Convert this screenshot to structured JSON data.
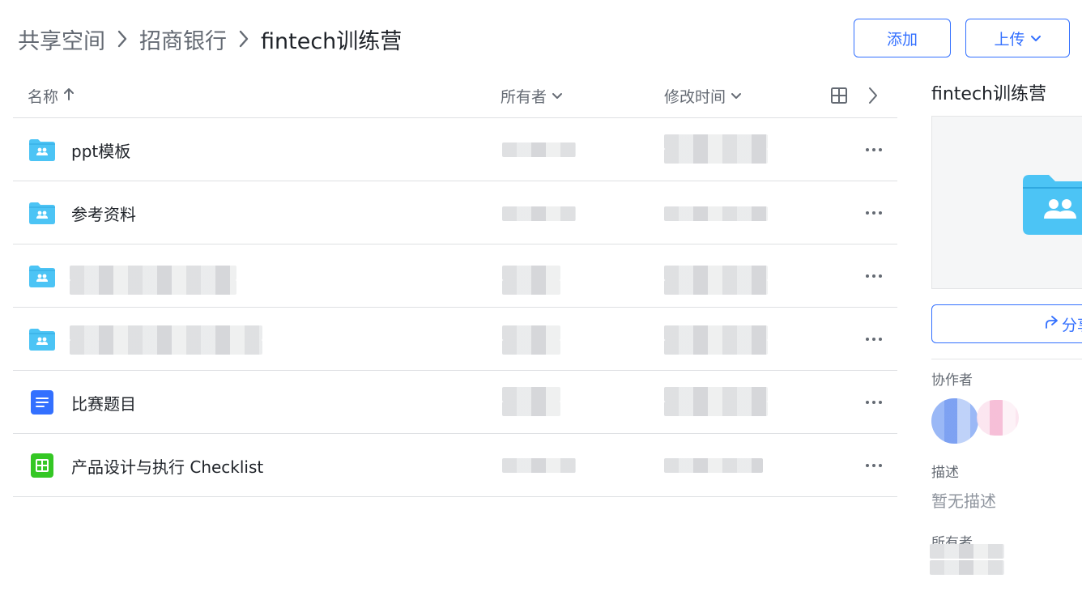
{
  "breadcrumb": [
    "共享空间",
    "招商银行",
    "fintech训练营"
  ],
  "buttons": {
    "add": "添加",
    "upload": "上传"
  },
  "columns": {
    "name": "名称",
    "owner": "所有者",
    "modified": "修改时间"
  },
  "files": [
    {
      "name": "ppt模板",
      "type": "shared-folder"
    },
    {
      "name": "参考资料",
      "type": "shared-folder"
    },
    {
      "name": "",
      "type": "shared-folder"
    },
    {
      "name": "",
      "type": "shared-folder"
    },
    {
      "name": "比赛题目",
      "type": "doc"
    },
    {
      "name": "产品设计与执行 Checklist",
      "type": "sheet"
    }
  ],
  "panel": {
    "title": "fintech训练营",
    "share": "分享",
    "collaborators_label": "协作者",
    "description_label": "描述",
    "description_value": "暂无描述",
    "owner_label": "所有者"
  },
  "colors": {
    "accent": "#3370ff",
    "folder": "#4cc4f5",
    "doc": "#3370ff",
    "sheet": "#34c724"
  },
  "icons": [
    "chevron-right-icon",
    "arrow-up-icon",
    "chevron-down-icon",
    "grid-view-icon",
    "more-icon",
    "share-icon",
    "shared-folder-icon",
    "doc-icon",
    "sheet-icon"
  ]
}
